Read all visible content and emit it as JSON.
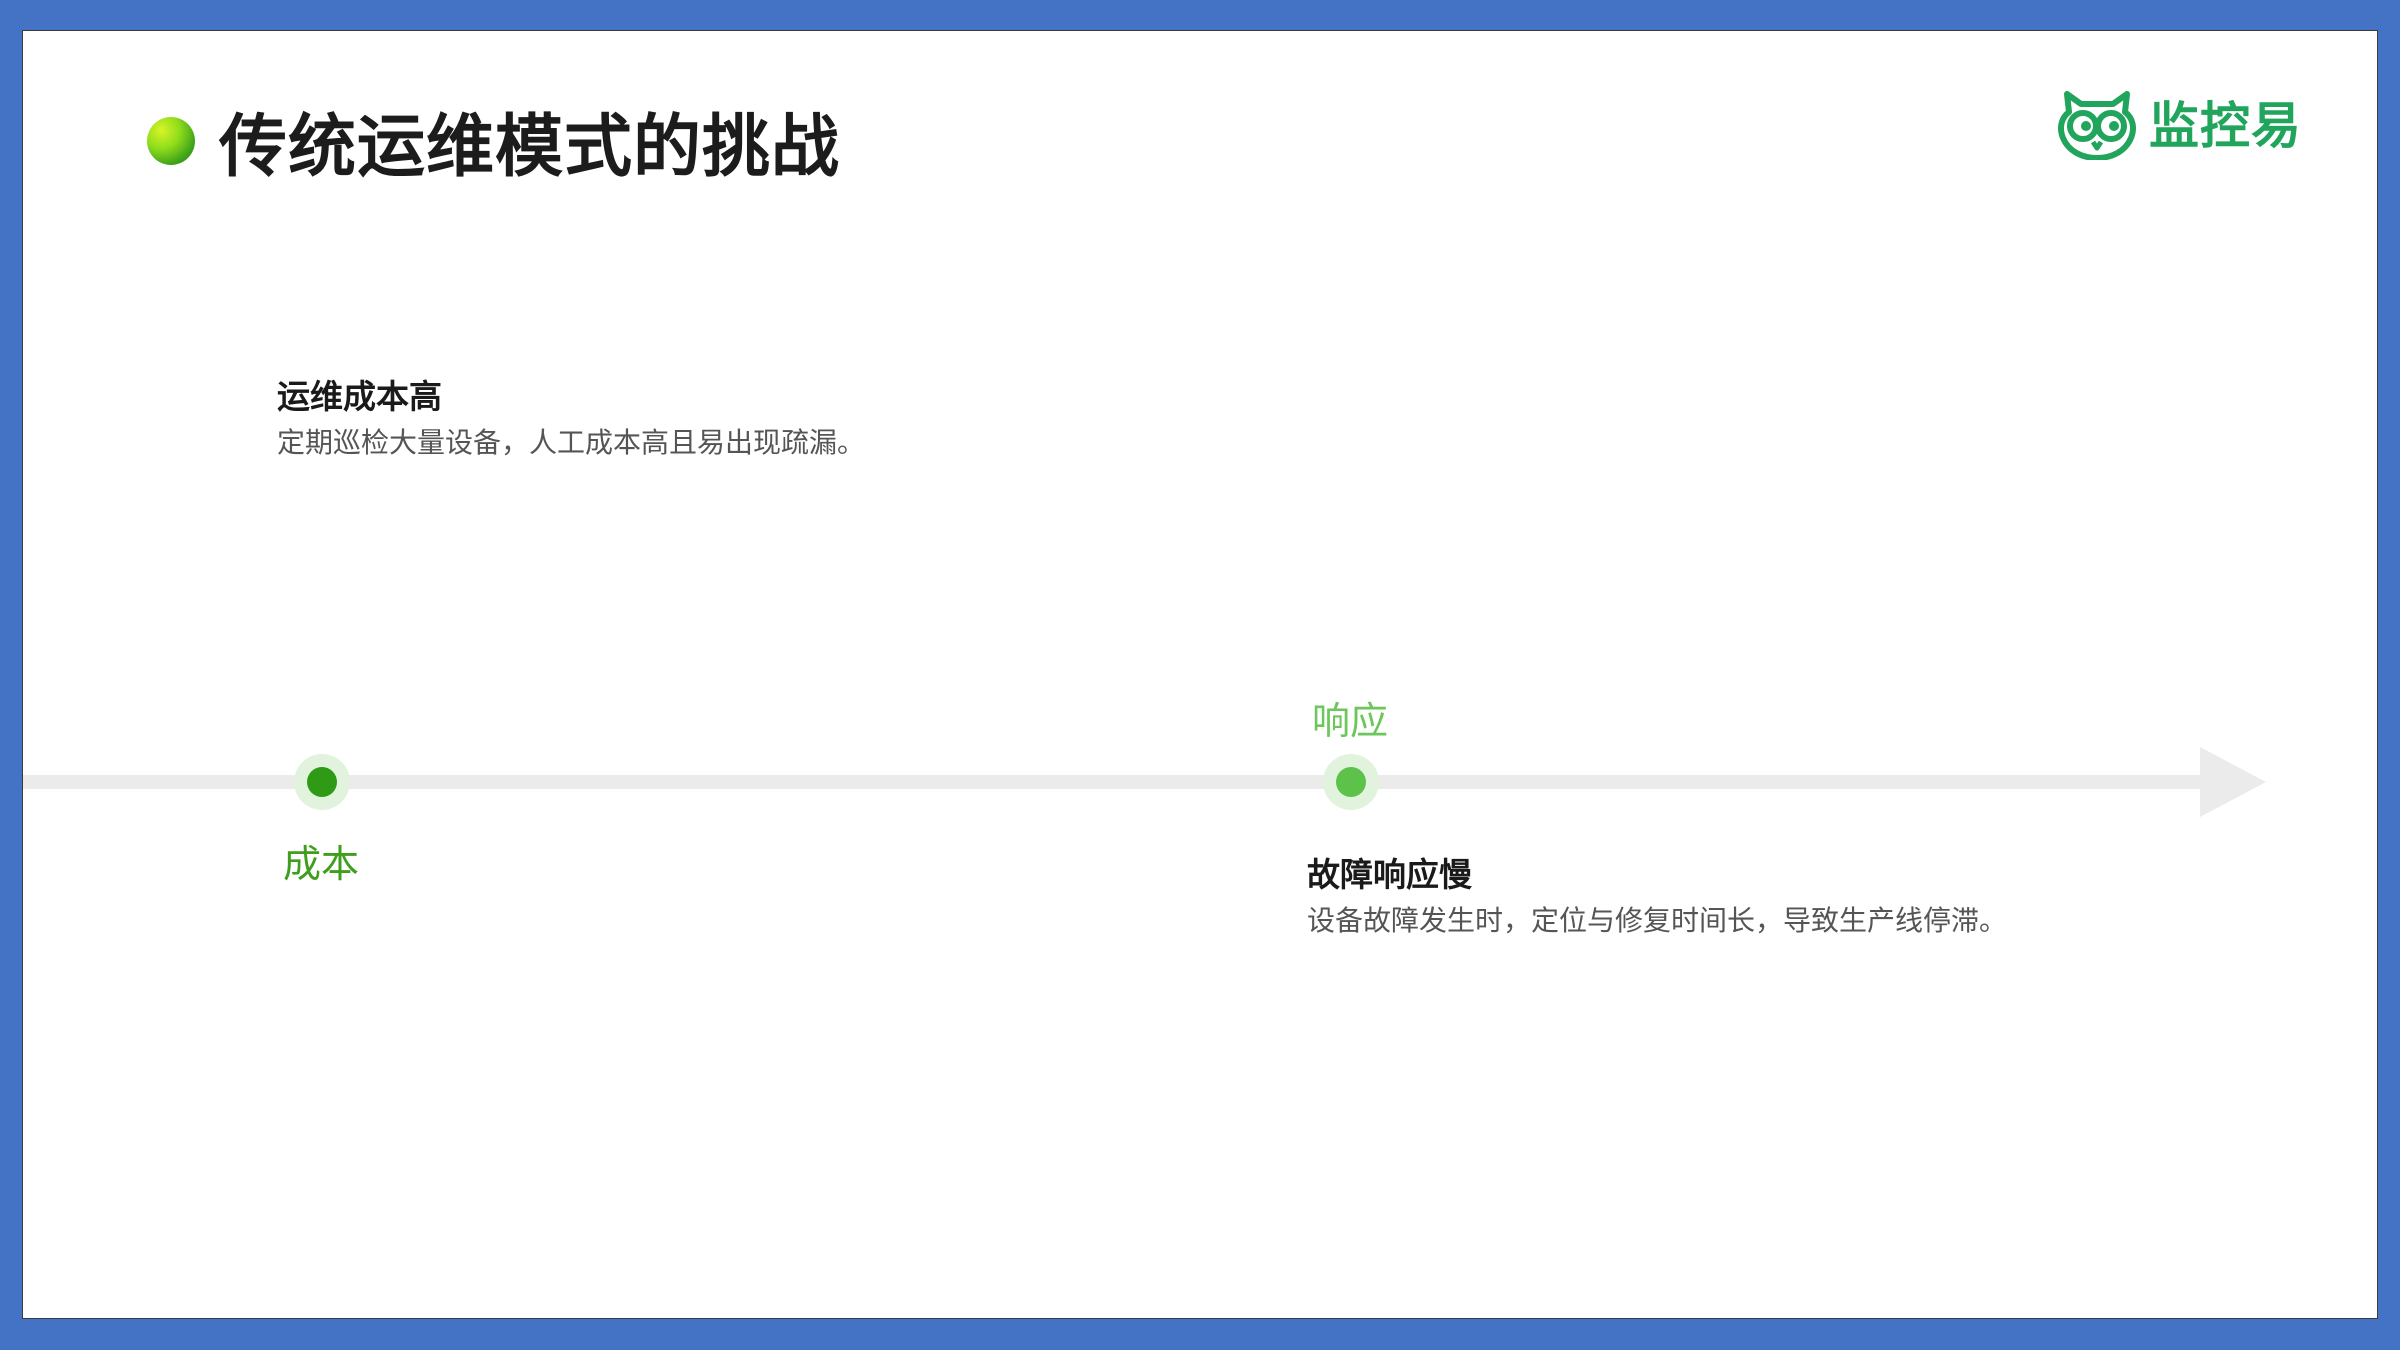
{
  "slide": {
    "title": "传统运维模式的挑战",
    "logo_text": "监控易",
    "colors": {
      "frame": "#4472c4",
      "logo_green": "#21a55d",
      "node_dark_green": "#2f9a16",
      "node_light_green": "#5cc24a",
      "timeline_gray": "#ebebeb"
    }
  },
  "cards": [
    {
      "title": "运维成本高",
      "description": "定期巡检大量设备，人工成本高且易出现疏漏。"
    },
    {
      "title": "故障响应慢",
      "description": "设备故障发生时，定位与修复时间长，导致生产线停滞。"
    }
  ],
  "timeline": {
    "nodes": [
      {
        "label": "成本",
        "label_position": "below"
      },
      {
        "label": "响应",
        "label_position": "above"
      }
    ]
  },
  "icons": {
    "title_bullet": "green-sphere-icon",
    "logo": "owl-icon",
    "timeline_end": "arrow-right-icon"
  }
}
